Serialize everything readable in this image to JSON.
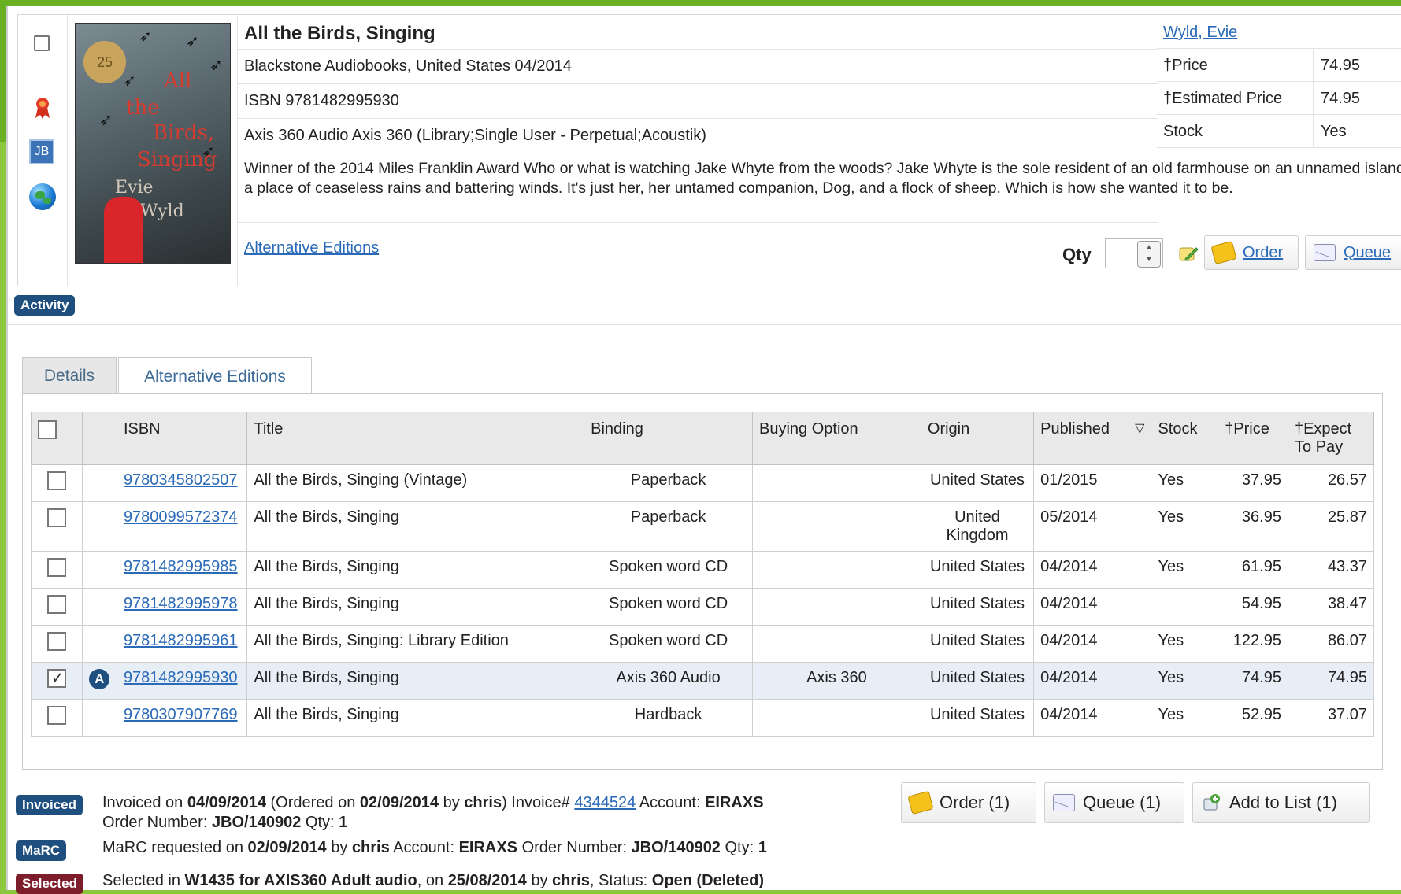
{
  "record": {
    "title": "All the Birds, Singing",
    "publisher_line": "Blackstone Audiobooks, United States 04/2014",
    "isbn_line": "ISBN 9781482995930",
    "format_line": "Axis 360 Audio Axis 360 (Library;Single User - Perpetual;Acoustik)",
    "description": "Winner of the 2014 Miles Franklin Award Who or what is watching Jake Whyte from the woods? Jake Whyte is the sole resident of an old farmhouse on an unnamed island, a place of ceaseless rains and battering winds. It's just her, her untamed companion, Dog, and a flock of sheep. Which is how she wanted it to be.",
    "alt_editions_link": "Alternative Editions",
    "author_link": "Wyld, Evie",
    "price_label": "†Price",
    "price_value": "74.95",
    "est_price_label": "†Estimated Price",
    "est_price_value": "74.95",
    "stock_label": "Stock",
    "stock_value": "Yes",
    "qty_label": "Qty",
    "qty_value": "",
    "order_label": "Order",
    "queue_label": "Queue",
    "cover": {
      "badge": "25",
      "title_lines": [
        "All",
        "the",
        "Birds,",
        "Singing"
      ],
      "author_lines": [
        "Evie",
        "Wyld"
      ]
    },
    "side_icons": [
      "award-ribbon-icon",
      "jb-icon",
      "globe-icon"
    ],
    "jb_label": "JB"
  },
  "activity_label": "Activity",
  "tabs": [
    {
      "label": "Details",
      "active": false
    },
    {
      "label": "Alternative Editions",
      "active": true
    }
  ],
  "table": {
    "headers": {
      "isbn": "ISBN",
      "title": "Title",
      "binding": "Binding",
      "buying_option": "Buying Option",
      "origin": "Origin",
      "published": "Published",
      "stock": "Stock",
      "price": "†Price",
      "expect_line1": "†Expect",
      "expect_line2": "To Pay"
    },
    "rows": [
      {
        "checked": false,
        "badge": "",
        "isbn": "9780345802507",
        "title": "All the Birds, Singing (Vintage)",
        "binding": "Paperback",
        "buying_option": "",
        "origin": "United States",
        "published": "01/2015",
        "stock": "Yes",
        "price": "37.95",
        "expect": "26.57"
      },
      {
        "checked": false,
        "badge": "",
        "isbn": "9780099572374",
        "title": "All the Birds, Singing",
        "binding": "Paperback",
        "buying_option": "",
        "origin": "United Kingdom",
        "published": "05/2014",
        "stock": "Yes",
        "price": "36.95",
        "expect": "25.87"
      },
      {
        "checked": false,
        "badge": "",
        "isbn": "9781482995985",
        "title": "All the Birds, Singing",
        "binding": "Spoken word CD",
        "buying_option": "",
        "origin": "United States",
        "published": "04/2014",
        "stock": "Yes",
        "price": "61.95",
        "expect": "43.37"
      },
      {
        "checked": false,
        "badge": "",
        "isbn": "9781482995978",
        "title": "All the Birds, Singing",
        "binding": "Spoken word CD",
        "buying_option": "",
        "origin": "United States",
        "published": "04/2014",
        "stock": "",
        "price": "54.95",
        "expect": "38.47"
      },
      {
        "checked": false,
        "badge": "",
        "isbn": "9781482995961",
        "title": "All the Birds, Singing: Library Edition",
        "binding": "Spoken word CD",
        "buying_option": "",
        "origin": "United States",
        "published": "04/2014",
        "stock": "Yes",
        "price": "122.95",
        "expect": "86.07"
      },
      {
        "checked": true,
        "badge": "A",
        "isbn": "9781482995930",
        "title": "All the Birds, Singing",
        "binding": "Axis 360 Audio",
        "buying_option": "Axis 360",
        "origin": "United States",
        "published": "04/2014",
        "stock": "Yes",
        "price": "74.95",
        "expect": "74.95"
      },
      {
        "checked": false,
        "badge": "",
        "isbn": "9780307907769",
        "title": "All the Birds, Singing",
        "binding": "Hardback",
        "buying_option": "",
        "origin": "United States",
        "published": "04/2014",
        "stock": "Yes",
        "price": "52.95",
        "expect": "37.07"
      }
    ]
  },
  "bulk_buttons": {
    "order": "Order (1)",
    "queue": "Queue (1)",
    "add_to_list": "Add to List (1)"
  },
  "activity": {
    "invoiced": {
      "badge": "Invoiced",
      "p1": "Invoiced on ",
      "date": "04/09/2014",
      "p2": " (Ordered on ",
      "ordered_date": "02/09/2014",
      "p3": " by ",
      "user": "chris",
      "p4": ") Invoice# ",
      "invoice_no": "4344524",
      "p5": " Account: ",
      "account": "EIRAXS",
      "p6": "Order Number: ",
      "order_no": "JBO/140902",
      "p7": " Qty: ",
      "qty": "1"
    },
    "marc": {
      "badge": "MaRC",
      "p1": "MaRC requested on ",
      "date": "02/09/2014",
      "p2": " by ",
      "user": "chris",
      "p3": " Account: ",
      "account": "EIRAXS",
      "p4": " Order Number: ",
      "order_no": "JBO/140902",
      "p5": " Qty: ",
      "qty": "1"
    },
    "selected": {
      "badge": "Selected",
      "p1": "Selected in ",
      "list": "W1435 for AXIS360 Adult audio",
      "p2": ", on ",
      "date": "25/08/2014",
      "p3": " by ",
      "user": "chris",
      "p4": ", Status: ",
      "status": "Open (Deleted)"
    }
  }
}
